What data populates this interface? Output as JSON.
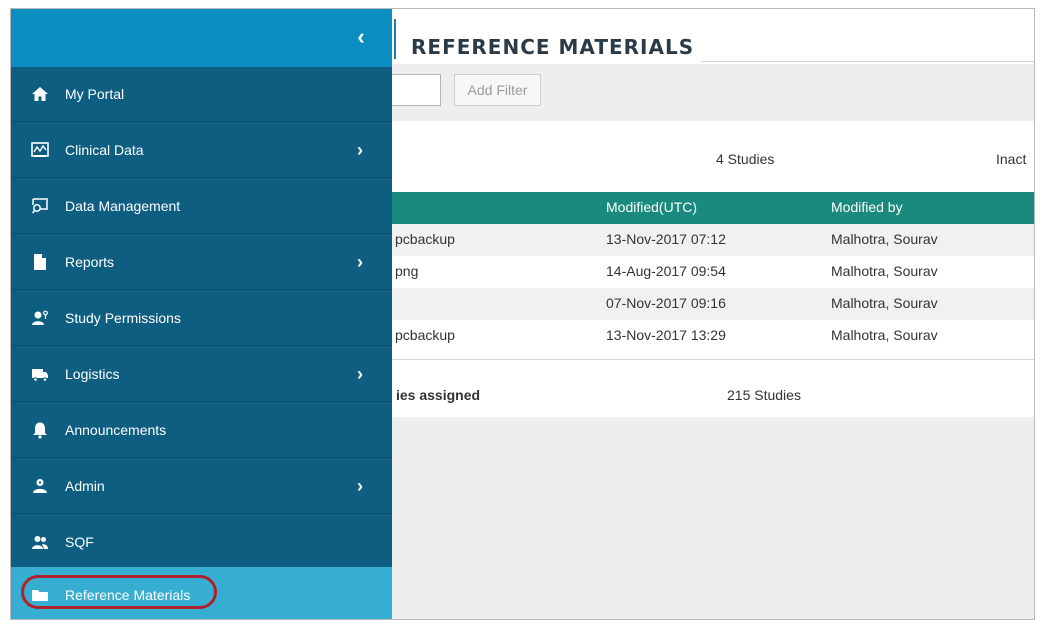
{
  "page": {
    "title": "REFERENCE MATERIALS",
    "add_filter_label": "Add Filter"
  },
  "summary": {
    "studies_count": "4 Studies",
    "inactive_partial": "Inact"
  },
  "table": {
    "headers": [
      "",
      "Modified(UTC)",
      "Modified by"
    ],
    "rows": [
      {
        "name": "pcbackup",
        "modified": "13-Nov-2017 07:12",
        "modified_by": "Malhotra, Sourav"
      },
      {
        "name": "png",
        "modified": "14-Aug-2017 09:54",
        "modified_by": "Malhotra, Sourav"
      },
      {
        "name": "",
        "modified": "07-Nov-2017 09:16",
        "modified_by": "Malhotra, Sourav"
      },
      {
        "name": "pcbackup",
        "modified": "13-Nov-2017 13:29",
        "modified_by": "Malhotra, Sourav"
      }
    ]
  },
  "assigned": {
    "label": "ies assigned",
    "count": "215 Studies"
  },
  "sidebar": {
    "collapse_icon": "chevron-left-icon",
    "items": [
      {
        "label": "My Portal",
        "icon": "home-icon",
        "has_submenu": false
      },
      {
        "label": "Clinical Data",
        "icon": "chart-monitor-icon",
        "has_submenu": true
      },
      {
        "label": "Data Management",
        "icon": "search-monitor-icon",
        "has_submenu": false
      },
      {
        "label": "Reports",
        "icon": "document-icon",
        "has_submenu": true
      },
      {
        "label": "Study Permissions",
        "icon": "user-key-icon",
        "has_submenu": false
      },
      {
        "label": "Logistics",
        "icon": "truck-icon",
        "has_submenu": true
      },
      {
        "label": "Announcements",
        "icon": "bell-icon",
        "has_submenu": false
      },
      {
        "label": "Admin",
        "icon": "user-gear-icon",
        "has_submenu": true
      },
      {
        "label": "SQF",
        "icon": "users-icon",
        "has_submenu": false
      },
      {
        "label": "Reference Materials",
        "icon": "folder-icon",
        "has_submenu": false,
        "active": true
      }
    ]
  },
  "colors": {
    "sidebar_bg": "#0e5e82",
    "sidebar_top": "#0a8ec0",
    "active_item": "#36aed1",
    "table_header": "#1a8a7e",
    "highlight_ring": "#b0202a"
  }
}
